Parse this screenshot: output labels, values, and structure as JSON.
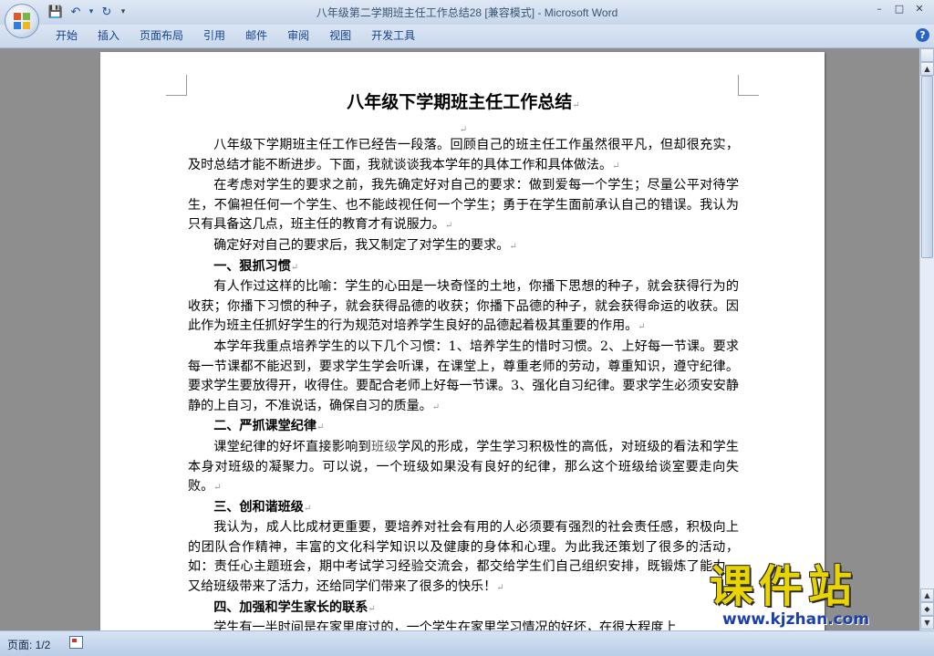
{
  "window": {
    "title": "八年级第二学期班主任工作总结28 [兼容模式]",
    "separator": " - ",
    "app_name": "Microsoft Word",
    "controls": [
      "–",
      "□",
      "✕"
    ]
  },
  "quick_access": {
    "save": "💾",
    "undo": "↶",
    "undo_dropdown": "▾",
    "redo": "↻",
    "customize": "▾"
  },
  "ribbon": {
    "tabs": [
      "开始",
      "插入",
      "页面布局",
      "引用",
      "邮件",
      "审阅",
      "视图",
      "开发工具"
    ],
    "help": "?"
  },
  "document": {
    "title": "八年级下学期班主任工作总结",
    "blank_mark": "↵",
    "blocks": [
      {
        "type": "para",
        "text": "八年级下学期班主任工作已经告一段落。回顾自己的班主任工作虽然很平凡，但却很充实，及时总结才能不断进步。下面，我就谈谈我本学年的具体工作和具体做法。"
      },
      {
        "type": "para",
        "text": "在考虑对学生的要求之前，我先确定好对自己的要求：做到爱每一个学生；尽量公平对待学生，不偏袒任何一个学生、也不能歧视任何一个学生；勇于在学生面前承认自己的错误。我认为只有具备这几点，班主任的教育才有说服力。"
      },
      {
        "type": "para",
        "text": "确定好对自己的要求后，我又制定了对学生的要求。"
      },
      {
        "type": "heading",
        "text": "一、狠抓习惯"
      },
      {
        "type": "para",
        "text": "有人作过这样的比喻：学生的心田是一块奇怪的土地，你播下思想的种子，就会获得行为的收获；你播下习惯的种子，就会获得品德的收获；你播下品德的种子，就会获得命运的收获。因此作为班主任抓好学生的行为规范对培养学生良好的品德起着极其重要的作用。"
      },
      {
        "type": "para",
        "text": "本学年我重点培养学生的以下几个习惯：1、培养学生的惜时习惯。2、上好每一节课。要求每一节课都不能迟到，要求学生学会听课，在课堂上，尊重老师的劳动，尊重知识，遵守纪律。要求学生要放得开，收得住。要配合老师上好每一节课。3、强化自习纪律。要求学生必须安安静静的上自习，不准说话，确保自习的质量。"
      },
      {
        "type": "heading",
        "text": "二、严抓课堂纪律"
      },
      {
        "type": "para_link",
        "before": "课堂纪律的好坏直接影响到",
        "link": "班级",
        "after": "学风的形成，学生学习积极性的高低，对班级的看法和学生本身对班级的凝聚力。可以说，一个班级如果没有良好的纪律，那么这个班级给谈室要走向失败。"
      },
      {
        "type": "heading",
        "text": "三、创和谐班级"
      },
      {
        "type": "para",
        "text": "我认为，成人比成材更重要，要培养对社会有用的人必须要有强烈的社会责任感，积极向上的团队合作精神，丰富的文化科学知识以及健康的身体和心理。为此我还策划了很多的活动，如：责任心主题班会，期中考试学习经验交流会，都交给学生们自己组织安排，既锻炼了能力，又给班级带来了活力，还给同学们带来了很多的快乐！"
      },
      {
        "type": "heading",
        "text": "四、加强和学生家长的联系"
      },
      {
        "type": "para",
        "text": "学生有一半时间是在家里度过的，一个学生在家里学习情况的好坏，在很大程度上"
      }
    ]
  },
  "scrollbar": {
    "up": "▲",
    "select": "◆",
    "down": "▼"
  },
  "status": {
    "page": "页面: 1/2"
  },
  "watermark": {
    "main": "课件站",
    "url": "www.kjzhan.com"
  },
  "colors": {
    "accent": "#15428b",
    "title_app": "#3a5475",
    "watermark_yellow": "#e8d400",
    "watermark_blue": "#1c3fa8"
  }
}
